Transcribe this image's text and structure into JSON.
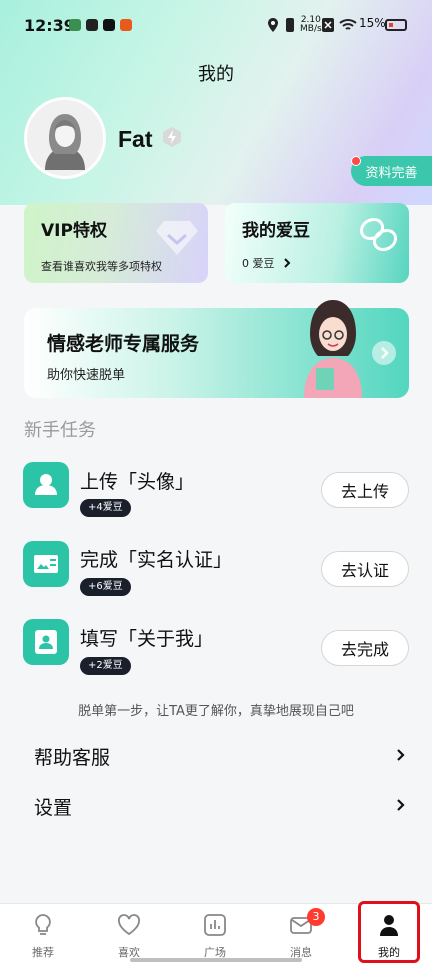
{
  "status_bar": {
    "time": "12:39",
    "net_speed_top": "2.10",
    "net_speed_bottom": "MB/s",
    "battery": "15%"
  },
  "page": {
    "title": "我的"
  },
  "profile": {
    "nickname": "Fat",
    "complete_button": "资料完善"
  },
  "cards": {
    "vip": {
      "title": "VIP特权",
      "subtitle": "查看谁喜欢我等多项特权"
    },
    "beans": {
      "title": "我的爱豆",
      "subtitle": "0 爱豆"
    }
  },
  "banner": {
    "title": "情感老师专属服务",
    "subtitle": "助你快速脱单"
  },
  "tasks": {
    "section_title": "新手任务",
    "items": [
      {
        "title": "上传「头像」",
        "reward": "+4爱豆",
        "button": "去上传",
        "icon": "user-icon"
      },
      {
        "title": "完成「实名认证」",
        "reward": "+6爱豆",
        "button": "去认证",
        "icon": "id-card-icon"
      },
      {
        "title": "填写「关于我」",
        "reward": "+2爱豆",
        "button": "去完成",
        "icon": "profile-card-icon"
      }
    ],
    "hint": "脱单第一步，让TA更了解你，真挚地展现自己吧"
  },
  "menu": {
    "help": "帮助客服",
    "settings": "设置"
  },
  "nav": {
    "items": [
      {
        "label": "推荐",
        "icon": "bulb-icon"
      },
      {
        "label": "喜欢",
        "icon": "heart-icon"
      },
      {
        "label": "广场",
        "icon": "chart-icon"
      },
      {
        "label": "消息",
        "icon": "mail-icon"
      },
      {
        "label": "我的",
        "icon": "person-icon"
      }
    ],
    "message_badge": "3"
  },
  "colors": {
    "accent": "#2cc4a6",
    "badge_red": "#ff3b30",
    "highlight": "#e0101b"
  }
}
